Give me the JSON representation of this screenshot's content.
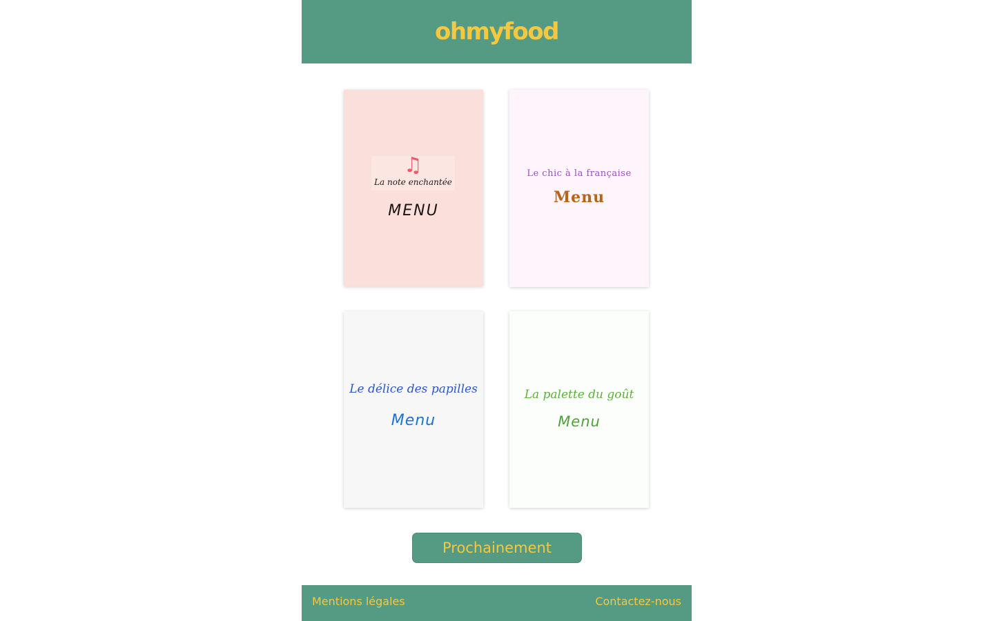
{
  "header": {
    "logo": "ohmyfood"
  },
  "cards": [
    {
      "name": "La note enchantée",
      "menu_label": "MENU",
      "icon": "music-note-icon",
      "note_glyph": "♫",
      "background": "#fadfdb"
    },
    {
      "name": "Le chic à la française",
      "menu_label": "Menu",
      "background": "#fdf4fc"
    },
    {
      "name": "Le délice des papilles",
      "menu_label": "Menu",
      "background": "#f7f7f7"
    },
    {
      "name": "La palette du goût",
      "menu_label": "Menu",
      "background": "#fbfefb"
    }
  ],
  "cta": {
    "label": "Prochainement"
  },
  "footer": {
    "left_link": "Mentions légales",
    "right_link": "Contactez-nous"
  },
  "colors": {
    "brand_green": "#559a83",
    "brand_yellow": "#f5c842"
  }
}
